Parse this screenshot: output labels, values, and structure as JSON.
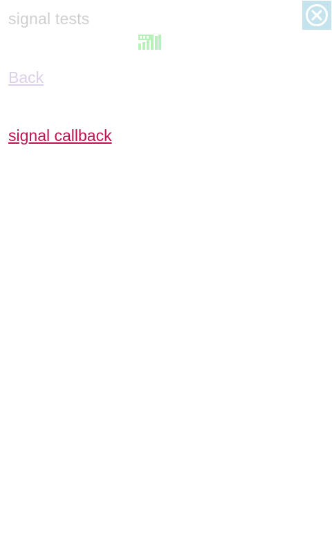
{
  "header": {
    "title": "signal tests",
    "close_icon": "close-icon"
  },
  "status": {
    "signal_icon": "signal-strength-icon",
    "signal_color": "#43d043"
  },
  "links": {
    "back_label": "Back",
    "callback_label": "signal callback"
  },
  "colors": {
    "title": "#cfcfcf",
    "close_bg": "#c4e3ec",
    "back_link": "#dccfe8",
    "callback_link": "#c0134e"
  }
}
